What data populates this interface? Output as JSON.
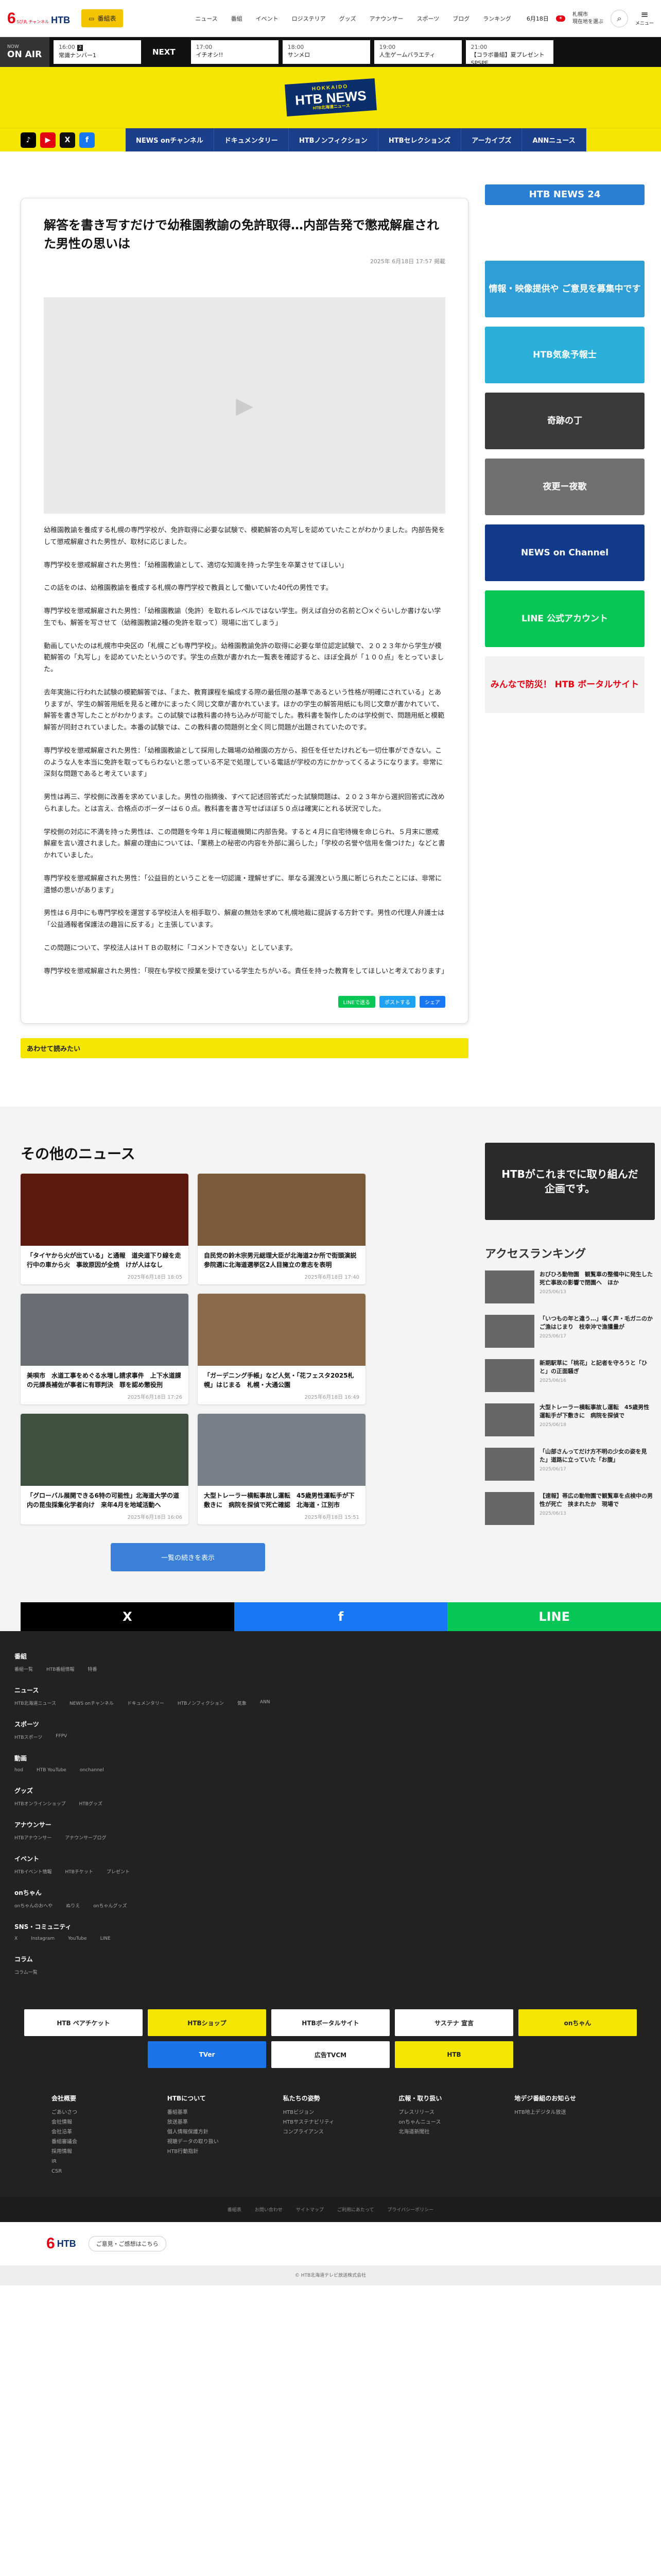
{
  "header": {
    "logo_num": "6",
    "logo_small": "5ぴ丸 チャンネル",
    "logo_name": "HTB",
    "tv_button": "番組表",
    "nav": [
      "ニュース",
      "番組",
      "イベント",
      "ロジステリア",
      "グッズ",
      "アナウンサー",
      "スポーツ",
      "ブログ",
      "ランキング"
    ],
    "date": "6月18日",
    "weather_line1": "札幌市",
    "weather_line2": "現在地を選ぶ",
    "weather_line3": "2℃/8℃",
    "search_label": "検索",
    "menu_label": "メニュー"
  },
  "ticker": {
    "onair_small": "NOW",
    "onair": "ON AIR",
    "now_time": "16:00",
    "now_tag": "2",
    "now_title": "常識ナンバー1",
    "next_label": "NEXT",
    "items": [
      {
        "time": "17:00",
        "title": "イチオシ!!"
      },
      {
        "time": "18:00",
        "title": "サンメロ"
      },
      {
        "time": "19:00",
        "title": "人生ゲームバラエティ"
      },
      {
        "time": "21:00",
        "title": "【コラボ番組】夏プレゼント SPSPE"
      }
    ]
  },
  "band": {
    "logo_top": "HOKKAIDO",
    "logo_brand": "HTB NEWS",
    "logo_sub": "HTB北海道ニュース"
  },
  "subnav": {
    "tabs": [
      "NEWS onチャンネル",
      "ドキュメンタリー",
      "HTBノンフィクション",
      "HTBセレクションズ",
      "アーカイブズ",
      "ANNニュース"
    ]
  },
  "article": {
    "title": "解答を書き写すだけで幼稚園教諭の免許取得…内部告発で懲戒解雇された男性の思いは",
    "date": "2025年 6月18日 17:57 掲載",
    "paragraphs": [
      "幼稚園教諭を養成する札幌の専門学校が、免許取得に必要な試験で、模範解答の丸写しを認めていたことがわかりました。内部告発をして懲戒解雇された男性が、取材に応じました。",
      "専門学校を懲戒解雇された男性：「幼稚園教諭として、適切な知識を持った学生を卒業させてほしい」",
      "この話をのは、幼稚園教諭を養成する札幌の専門学校で教員として働いていた40代の男性です。",
      "専門学校を懲戒解雇された男性：「幼稚園教諭（免許）を取れるレベルではない学生。例えば自分の名前と〇×ぐらいしか書けない学生でも、解答を写させて（幼稚園教諭2種の免許を取って）現場に出てしまう」",
      "動画していたのは札幌市中央区の「札幌こども専門学校」。幼稚園教諭免許の取得に必要な単位認定試験で、２０２３年から学生が模範解答の「丸写し」を認めていたというのです。学生の点数が書かれた一覧表を確認すると、ほぼ全員が「１００点」をとっていました。",
      "去年実施に行われた試験の模範解答では、「また、教育課程を編成する際の最低限の基準であるという性格が明確にされている」とありますが、学生の解答用紙を見ると確かにまったく同じ文章が書かれています。ほかの学生の解答用紙にも同じ文章が書かれていて、解答を書き写したことがわかります。この試験では教科書の持ち込みが可能でした。教科書を製作したのは学校側で、問題用紙と模範解答が同封されていました。本番の試験では、この教科書の問題例と全く同じ問題が出題されていたのです。",
      "専門学校を懲戒解雇された男性：「幼稚園教諭として採用した職場の幼稚園の方から、担任を任せたけれども一切仕事ができない。このような人を本当に免許を取ってもらわないと思っている不足で処理している電話が学校の方にかかってくるようになります。非常に深刻な問題であると考えています」",
      "男性は再三、学校側に改善を求めていました。男性の指摘後、すべて記述回答式だった試験問題は、２０２３年から選択回答式に改められました。とは言え、合格点のボーダーは６０点。教科書を書き写せばほぼ５０点は確実にとれる状況でした。",
      "学校側の対応に不満を持った男性は、この問題を今年１月に報道機関に内部告発。すると４月に自宅待機を命じられ、５月末に懲戒解雇を言い渡されました。解雇の理由については、「業務上の秘密の内容を外部に漏らした」「学校の名誉や信用を傷つけた」などと書かれていました。",
      "専門学校を懲戒解雇された男性：「公益目的ということを一切認識・理解せずに、単なる漏洩という風に断じられたことには、非常に遺憾の思いがあります」",
      "男性は６月中にも専門学校を運営する学校法人を相手取り、解雇の無効を求めて札幌地裁に提訴する方針です。男性の代理人弁護士は「公益通報者保護法の趣旨に反する」と主張しています。",
      "この問題について、学校法人はＨＴＢの取材に「コメントできない」としています。",
      "専門学校を懲戒解雇された男性：「現在も学校で授業を受けている学生たちがいる。責任を持った教育をしてほしいと考えております」"
    ],
    "share": [
      "LINEで送る",
      "ポストする",
      "シェア"
    ],
    "related_label": "あわせて読みたい"
  },
  "sidebar": {
    "banners": [
      {
        "text": "HTB NEWS 24",
        "color": "#2a7fd4"
      },
      {
        "text": "情報・映像提供や ご意見を募集中です",
        "color": "#2f9ed6"
      },
      {
        "text": "HTB気象予報士",
        "color": "#2ab0d8"
      },
      {
        "text": "奇跡の丁",
        "color": "#3a3a3a"
      },
      {
        "text": "夜更ー夜歌",
        "color": "#707070"
      },
      {
        "text": "NEWS on Channel",
        "color": "#123a8a"
      },
      {
        "text": "LINE 公式アカウント",
        "color": "#06c755"
      },
      {
        "text": "みんなで防災！ HTB ボータルサイト",
        "color": "#f2f2f2"
      }
    ]
  },
  "news": {
    "heading": "その他のニュース",
    "items": [
      {
        "title": "「タイヤから火が出ている」と通報　道央道下り線を走行中の車から火　事故原因が全焼　けが人はなし",
        "date": "2025年6月18日 18:05",
        "img": "#5a1a10"
      },
      {
        "title": "自民党の鈴木宗男元総理大臣が北海道2か所で街頭演説　参院選に北海道選挙区2人目擁立の意志を表明",
        "date": "2025年6月18日 17:40",
        "img": "#7a5a3a"
      },
      {
        "title": "美唄市　水道工事をめぐる水増し請求事件　上下水道課の元課長補佐が事者に有罪判決　罪を認め懲役刑",
        "date": "2025年6月18日 17:26",
        "img": "#6a6e72"
      },
      {
        "title": "「ガーデニング手帳」など人気・「花フェスタ2025札幌」はじまる　札幌・大通公園",
        "date": "2025年6月18日 16:49",
        "img": "#8a6a4a"
      },
      {
        "title": "「グローバル展開できる6特の可能性」北海道大学の道内の昆虫採集化学者向け　来年4月を地域活動へ",
        "date": "2025年6月18日 16:06",
        "img": "#405040"
      },
      {
        "title": "大型トレーラー横転事故し運転　45歳男性運転手が下敷きに　病院を探偵で死亡確認　北海道・江別市",
        "date": "2025年6月18日 15:51",
        "img": "#7a8088"
      }
    ],
    "more_button": "一覧の続きを表示"
  },
  "ranking": {
    "heading": "アクセスランキング",
    "ad": "HTBがこれまでに取り組んだ企画です。",
    "items": [
      {
        "title": "おびひろ動物園　観覧車の整備中に発生した死亡事故の影響で閉園へ　ほか",
        "date": "2025/06/13"
      },
      {
        "title": "「いつもの年と違う…」嘆く声・毛ガニのかご漁はじまり　枝幸沖で漁獲量が",
        "date": "2025/06/17"
      },
      {
        "title": "新期駅草に「桃花」と記者を守ろうと「ひと」の正面騒ぎ",
        "date": "2025/06/16"
      },
      {
        "title": "大型トレーラー横転事故し運転　45歳男性運転手が下敷きに　病院を探偵で",
        "date": "2025/06/18"
      },
      {
        "title": "「山部さんってだけ方不明の少女の姿を見た」道路に立っていた「お腹」",
        "date": "2025/06/17"
      },
      {
        "title": "【速報】帯広の動物園で観覧車を点検中の男性が死亡　挟まれたか　現場で",
        "date": "2025/06/13"
      }
    ]
  },
  "share_bar": {
    "x": "X",
    "fb": "f",
    "line": "LINE"
  },
  "footer_sections": [
    {
      "title": "番組",
      "links": [
        "番組一覧",
        "HTB番組情報",
        "特番"
      ]
    },
    {
      "title": "ニュース",
      "links": [
        "HTB北海道ニュース",
        "NEWS onチャンネル",
        "ドキュメンタリー",
        "HTBノンフィクション",
        "気象",
        "ANN"
      ]
    },
    {
      "title": "スポーツ",
      "links": [
        "HTBスポーツ",
        "FFPV"
      ]
    },
    {
      "title": "動画",
      "links": [
        "hod",
        "HTB YouTube",
        "onchannel"
      ]
    },
    {
      "title": "グッズ",
      "links": [
        "HTBオンラインショップ",
        "HTBグッズ"
      ]
    },
    {
      "title": "アナウンサー",
      "links": [
        "HTBアナウンサー",
        "アナウンサーブログ"
      ]
    },
    {
      "title": "イベント",
      "links": [
        "HTBイベント情報",
        "HTBチケット",
        "プレゼント"
      ]
    },
    {
      "title": "onちゃん",
      "links": [
        "onちゃんのおへや",
        "ぬりえ",
        "onちゃんグッズ"
      ]
    },
    {
      "title": "SNS・コミュニティ",
      "links": [
        "X",
        "Instagram",
        "YouTube",
        "LINE"
      ]
    },
    {
      "title": "コラム",
      "links": [
        "コラム一覧"
      ]
    }
  ],
  "footer_banners": [
    "HTB ペアチケット",
    "HTBショップ",
    "HTBボータルサイト",
    "サステナ 宣言",
    "onちゃん",
    "TVer",
    "広告TVCM",
    "HTB"
  ],
  "footer_cols": [
    {
      "title": "会社概要",
      "items": [
        "ごあいさつ",
        "会社情報",
        "会社沿革",
        "番組審議会",
        "採用情報",
        "IR",
        "CSR"
      ]
    },
    {
      "title": "HTBについて",
      "items": [
        "番組基準",
        "放送基準",
        "個人情報保護方針",
        "視聴データの取り扱い",
        "HTB行動指針"
      ]
    },
    {
      "title": "私たちの姿勢",
      "items": [
        "HTBビジョン",
        "HTBサステナビリティ",
        "コンプライアンス"
      ]
    },
    {
      "title": "広報・取り扱い",
      "items": [
        "プレスリリース",
        "onちゃんニュース",
        "北海道新聞社"
      ]
    },
    {
      "title": "地デジ番組のお知らせ",
      "items": [
        "HTB地上デジタル放送"
      ]
    }
  ],
  "footer_bottom": [
    "番組表",
    "お問い合わせ",
    "サイトマップ",
    "ご利用にあたって",
    "プライバシーポリシー"
  ],
  "footer_foot": "ご意見・ご感想はこちら",
  "copyright": "© HTB北海道テレビ放送株式会社"
}
